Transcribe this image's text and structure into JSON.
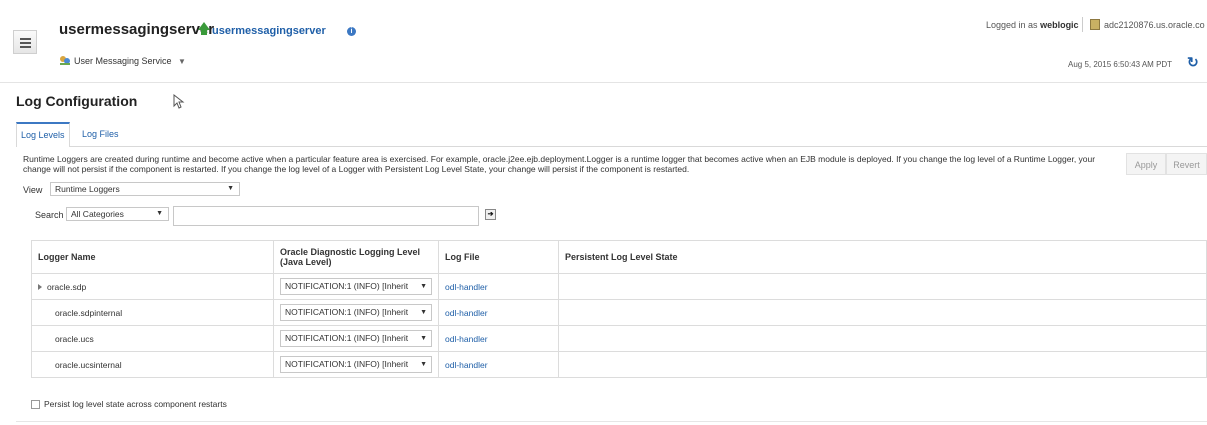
{
  "header": {
    "server_title": "usermessagingserver",
    "server_link": "usermessagingserver",
    "service_menu": "User Messaging Service",
    "logged_in_prefix": "Logged in as",
    "logged_in_user": "weblogic",
    "host": "adc2120876.us.oracle.co",
    "timestamp": "Aug 5, 2015 6:50:43 AM PDT"
  },
  "page": {
    "title": "Log Configuration",
    "tabs": [
      {
        "label": "Log Levels",
        "active": true
      },
      {
        "label": "Log Files",
        "active": false
      }
    ],
    "description": "Runtime Loggers are created during runtime and become active when a particular feature area is exercised. For example, oracle.j2ee.ejb.deployment.Logger is a runtime logger that becomes active when an EJB module is deployed. If you change the log level of a Runtime Logger, your change will not persist if the component is restarted. If you change the log level of a Logger with Persistent Log Level State, your change will persist if the component is restarted.",
    "apply_label": "Apply",
    "revert_label": "Revert"
  },
  "filters": {
    "view_label": "View",
    "view_value": "Runtime Loggers",
    "search_label": "Search",
    "search_category": "All Categories",
    "search_value": ""
  },
  "table": {
    "columns": [
      "Logger Name",
      "Oracle Diagnostic Logging Level (Java Level)",
      "Log File",
      "Persistent Log Level State"
    ],
    "rows": [
      {
        "name": "oracle.sdp",
        "level": "NOTIFICATION:1 (INFO) [Inherit",
        "log_file": "odl-handler",
        "persistent": ""
      },
      {
        "name": "oracle.sdpinternal",
        "level": "NOTIFICATION:1 (INFO) [Inherit",
        "log_file": "odl-handler",
        "persistent": ""
      },
      {
        "name": "oracle.ucs",
        "level": "NOTIFICATION:1 (INFO) [Inherit",
        "log_file": "odl-handler",
        "persistent": ""
      },
      {
        "name": "oracle.ucsinternal",
        "level": "NOTIFICATION:1 (INFO) [Inherit",
        "log_file": "odl-handler",
        "persistent": ""
      }
    ]
  },
  "persist_checkbox_label": "Persist log level state across component restarts",
  "colors": {
    "link": "#1f5fa8",
    "accent": "#3c78c3",
    "status_up": "#3a9a3a"
  }
}
